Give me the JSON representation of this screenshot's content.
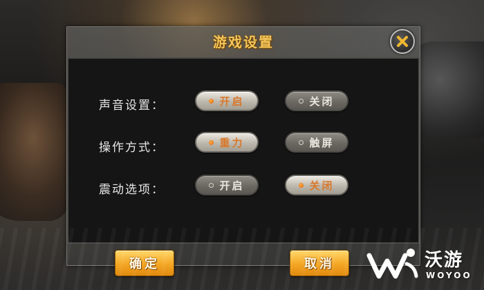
{
  "dialog": {
    "title": "游戏设置",
    "close_icon": "close-x-icon"
  },
  "settings": [
    {
      "label": "声音设置：",
      "options": [
        {
          "label": "开启",
          "selected": true
        },
        {
          "label": "关闭",
          "selected": false
        }
      ]
    },
    {
      "label": "操作方式：",
      "options": [
        {
          "label": "重力",
          "selected": true
        },
        {
          "label": "触屏",
          "selected": false
        }
      ]
    },
    {
      "label": "震动选项：",
      "options": [
        {
          "label": "开启",
          "selected": false
        },
        {
          "label": "关闭",
          "selected": true
        }
      ]
    }
  ],
  "buttons": {
    "confirm": "确定",
    "cancel": "取消"
  },
  "watermark": {
    "cn": "沃游",
    "en": "WOYOO"
  },
  "colors": {
    "title": "#f4c65a",
    "selected_text": "#d8782a",
    "action_button": "#f4a623"
  }
}
